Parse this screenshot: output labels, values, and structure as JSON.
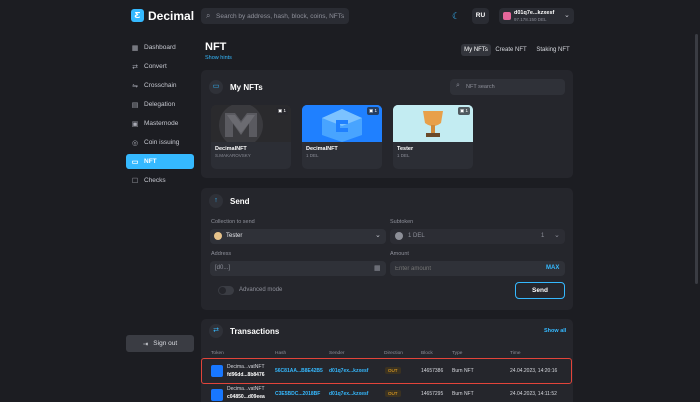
{
  "app": {
    "name": "Decimal",
    "logo_letter": "Ƹ"
  },
  "header": {
    "search_placeholder": "Search by address, hash, block, coins, NFTs",
    "language": "RU",
    "account_address": "d01q7e...kzxesf",
    "account_balance": "97.178.150 DEL"
  },
  "sidebar": {
    "items": [
      {
        "label": "Dashboard",
        "icon": "grid-icon",
        "glyph": "▦"
      },
      {
        "label": "Convert",
        "icon": "convert-icon",
        "glyph": "⇄"
      },
      {
        "label": "Crosschain",
        "icon": "crosschain-icon",
        "glyph": "⇋"
      },
      {
        "label": "Delegation",
        "icon": "delegation-icon",
        "glyph": "▤"
      },
      {
        "label": "Masternode",
        "icon": "masternode-icon",
        "glyph": "▣"
      },
      {
        "label": "Coin issuing",
        "icon": "coin-icon",
        "glyph": "◎"
      },
      {
        "label": "NFT",
        "icon": "nft-icon",
        "glyph": "▭"
      },
      {
        "label": "Checks",
        "icon": "checks-icon",
        "glyph": "☐"
      }
    ],
    "active": "NFT",
    "signout_label": "Sign out"
  },
  "page": {
    "title": "NFT",
    "show_hints": "Show hints",
    "tabs": [
      "My NFTs",
      "Create NFT",
      "Staking NFT"
    ],
    "active_tab": "My NFTs"
  },
  "my_nfts": {
    "title": "My NFTs",
    "search_placeholder": "NFT search",
    "items": [
      {
        "name": "DecimalNFT",
        "owner": "S.MAKAROVSKY",
        "count": "1"
      },
      {
        "name": "DecimalNFT",
        "owner": "1 DEL",
        "count": "1"
      },
      {
        "name": "Tester",
        "owner": "1 DEL",
        "count": "1"
      }
    ]
  },
  "send": {
    "title": "Send",
    "collection_label": "Collection to send",
    "collection_value": "Tester",
    "subtoken_label": "Subtoken",
    "subtoken_value": "1 DEL",
    "subtoken_count": "1",
    "address_label": "Address",
    "address_value": "[d0...]",
    "amount_label": "Amount",
    "amount_placeholder": "Enter amount",
    "max_label": "MAX",
    "advanced_label": "Advanced mode",
    "send_button": "Send"
  },
  "transactions": {
    "title": "Transactions",
    "show_all": "Show all",
    "columns": [
      "Token",
      "Hash",
      "Sender",
      "Direction",
      "Block",
      "Type",
      "Time"
    ],
    "rows": [
      {
        "token_name": "Decima...vatNFT",
        "token_id": "fd96dd...8b8476",
        "hash": "56C81AA...B8E42B5",
        "sender": "d01q7ex...kzxesf",
        "direction": "OUT",
        "block": "14657386",
        "type": "Burn NFT",
        "time": "24.04.2023, 14:20:16"
      },
      {
        "token_name": "Decima...vatNFT",
        "token_id": "c04850...d09eea",
        "hash": "C3E5BDC...2018BF",
        "sender": "d01q7ex...kzxesf",
        "direction": "OUT",
        "block": "14657295",
        "type": "Burn NFT",
        "time": "24.04.2023, 14:11:52"
      }
    ]
  },
  "colors": {
    "accent": "#35b9ff",
    "background": "#1c1d22",
    "card": "#25262c",
    "highlight": "#e2443a"
  }
}
